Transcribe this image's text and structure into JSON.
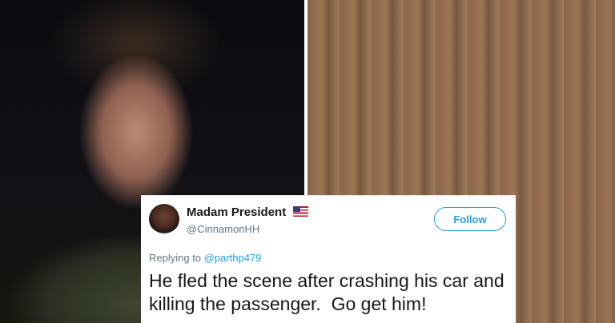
{
  "tweet": {
    "display_name": "Madam President",
    "handle": "@CinnamonHH",
    "follow_label": "Follow",
    "replying_prefix": "Replying to ",
    "replying_to": "@parthp479",
    "text_lines": [
      "He fled the scene after crashing his car and",
      "killing the passenger.  Go get him!"
    ],
    "accent_color": "#1da1f2",
    "icons": {
      "verified_flag": "us-flag-icon"
    }
  }
}
